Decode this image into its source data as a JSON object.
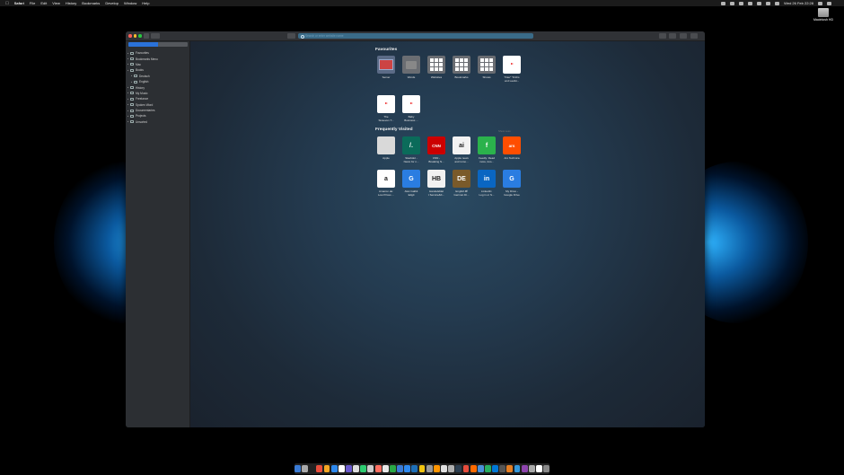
{
  "menubar": {
    "apple": "",
    "app": "Safari",
    "items": [
      "File",
      "Edit",
      "View",
      "History",
      "Bookmarks",
      "Develop",
      "Window",
      "Help"
    ],
    "clock": "Wed 26 Feb 22:28"
  },
  "desktop": {
    "drive_label": "Macintosh HD"
  },
  "sidebar": {
    "items": [
      {
        "label": "Favourites",
        "indent": false
      },
      {
        "label": "Bookmarks Menu",
        "indent": false
      },
      {
        "label": "Mac",
        "indent": false
      },
      {
        "label": "Books",
        "indent": false
      },
      {
        "label": "Deutsch",
        "indent": true
      },
      {
        "label": "English",
        "indent": true
      },
      {
        "label": "History",
        "indent": false
      },
      {
        "label": "My Music",
        "indent": false
      },
      {
        "label": "Freelance",
        "indent": false
      },
      {
        "label": "Spoken Word",
        "indent": false
      },
      {
        "label": "Documentaries",
        "indent": false
      },
      {
        "label": "Projects",
        "indent": false
      },
      {
        "label": "Unsorted",
        "indent": false
      }
    ]
  },
  "favourites": {
    "title": "Favourites",
    "tiles": [
      {
        "label": "Server",
        "color": "#5b6b86"
      },
      {
        "label": "Words",
        "color": "#6a6d72"
      },
      {
        "label": "Websites",
        "color": "#6a6d72"
      },
      {
        "label": "Bookmarks",
        "color": "#6a6d72"
      },
      {
        "label": "Shows",
        "color": "#6a6d72"
      },
      {
        "label": "\"Das\" \"Frühs\nund Laufst...",
        "color": "#ffffff"
      },
      {
        "label": "The\nSixseven T...",
        "color": "#ffffff"
      },
      {
        "label": "Baby\nBusiness ...",
        "color": "#ffffff"
      }
    ]
  },
  "frequent": {
    "title": "Frequently Visited",
    "show_more": "Show Less",
    "tiles": [
      {
        "label": "Apple",
        "glyph": "",
        "color": "#d9d9d9"
      },
      {
        "label": "Slashdot -\nNews for n...",
        "glyph": "/.",
        "color": "#0b6b5a"
      },
      {
        "label": "CNN -\nBreaking N...",
        "glyph": "CNN",
        "color": "#cc0000"
      },
      {
        "label": "Apple news\nand rumo...",
        "glyph": "ai",
        "color": "#f2f2f2"
      },
      {
        "label": "Feedly: Read\nmore, kno...",
        "glyph": "f",
        "color": "#2bb24c"
      },
      {
        "label": "Ars Technica",
        "glyph": "ars",
        "color": "#ff4e00"
      },
      {
        "label": "Amazon.de:\nLow Prices ...",
        "glyph": "a",
        "color": "#ffffff"
      },
      {
        "label": "Alan Galbit\nEdgit",
        "glyph": "G",
        "color": "#2a7de1"
      },
      {
        "label": "Handelsblat\nt Service&K...",
        "glyph": "HB",
        "color": "#f1f1f1"
      },
      {
        "label": "English ⇄\nGerman Di...",
        "glyph": "DE",
        "color": "#7a5a2a"
      },
      {
        "label": "LinkedIn:\nLog in or S...",
        "glyph": "in",
        "color": "#0a66c2"
      },
      {
        "label": "My Drive -\nGoogle Drive",
        "glyph": "G",
        "color": "#2a7de1"
      }
    ]
  },
  "address": {
    "placeholder": "Search or enter website name"
  },
  "dock": {
    "colors": [
      "#3a7bd5",
      "#aaaaaa",
      "#222222",
      "#e94e3c",
      "#f5a623",
      "#2d89ef",
      "#ffffff",
      "#6a5acd",
      "#dddddd",
      "#2ecc71",
      "#cccccc",
      "#ff6f61",
      "#e8e8e8",
      "#2aa845",
      "#3a7bd5",
      "#2d89ef",
      "#1d6fb8",
      "#f1c40f",
      "#999999",
      "#ff9500",
      "#e0e0e0",
      "#b0b0b0",
      "#2c3e50",
      "#e74c3c",
      "#ff6a00",
      "#4a90d9",
      "#27ae60",
      "#0078d7",
      "#555555",
      "#e67e22",
      "#3498db",
      "#8e44ad",
      "#aaaaaa",
      "#ffffff",
      "#888888"
    ]
  }
}
